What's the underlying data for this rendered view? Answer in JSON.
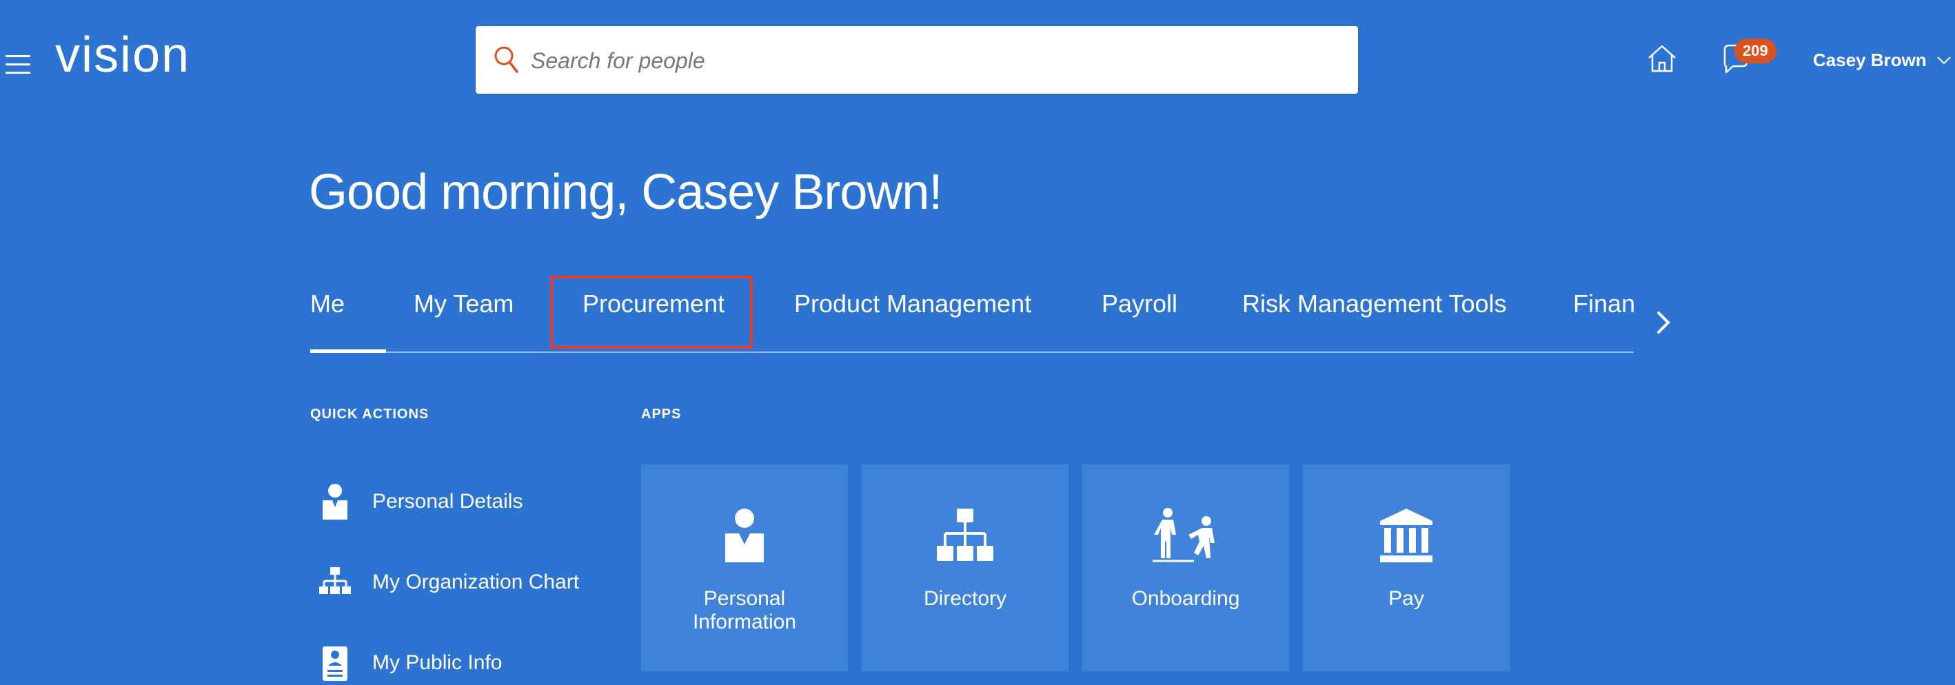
{
  "header": {
    "logo": "vision",
    "search_placeholder": "Search for people",
    "notification_count": "209",
    "user_name": "Casey Brown"
  },
  "greeting": "Good morning, Casey Brown!",
  "tabs": [
    {
      "label": "Me",
      "active": true
    },
    {
      "label": "My Team"
    },
    {
      "label": "Procurement",
      "highlighted": true
    },
    {
      "label": "Product Management"
    },
    {
      "label": "Payroll"
    },
    {
      "label": "Risk Management Tools"
    },
    {
      "label": "Finan"
    }
  ],
  "quick_actions": {
    "title": "QUICK ACTIONS",
    "items": [
      {
        "label": "Personal Details",
        "icon": "person-icon"
      },
      {
        "label": "My Organization Chart",
        "icon": "org-chart-icon"
      },
      {
        "label": "My Public Info",
        "icon": "id-card-icon"
      }
    ]
  },
  "apps": {
    "title": "APPS",
    "tiles": [
      {
        "label": "Personal Information",
        "icon": "person-icon"
      },
      {
        "label": "Directory",
        "icon": "org-chart-icon"
      },
      {
        "label": "Onboarding",
        "icon": "onboarding-icon"
      },
      {
        "label": "Pay",
        "icon": "bank-icon"
      }
    ]
  },
  "colors": {
    "background": "#2d74d2",
    "tile": "#3f83da",
    "badge": "#d9531e",
    "highlight_border": "#e53b2c",
    "search_icon": "#d9531e"
  }
}
